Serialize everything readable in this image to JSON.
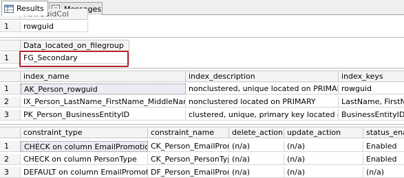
{
  "tabs": [
    {
      "label": "Results",
      "icon": "results-grid-icon",
      "active": true
    },
    {
      "label": "Messages",
      "icon": "messages-icon",
      "active": false
    }
  ],
  "grid1": {
    "columns": [
      "RowGuidCol"
    ],
    "rows": [
      [
        "1",
        "rowguid"
      ]
    ]
  },
  "grid2": {
    "columns": [
      "Data_located_on_filegroup"
    ],
    "rows": [
      [
        "1",
        "FG_Secondary"
      ]
    ]
  },
  "grid3": {
    "columns": [
      "index_name",
      "index_description",
      "index_keys"
    ],
    "rows": [
      [
        "1",
        "AK_Person_rowguid",
        "nonclustered, unique located on PRIMARY",
        "rowguid"
      ],
      [
        "2",
        "IX_Person_LastName_FirstName_MiddleName",
        "nonclustered located on PRIMARY",
        "LastName, FirstNa"
      ],
      [
        "3",
        "PK_Person_BusinessEntityID",
        "clustered, unique, primary key located on ...",
        "BusinessEntityID"
      ]
    ]
  },
  "grid4": {
    "columns": [
      "constraint_type",
      "constraint_name",
      "delete_action",
      "update_action",
      "status_ena"
    ],
    "rows": [
      [
        "1",
        "CHECK on column EmailPromotion",
        "CK_Person_EmailPromotion",
        "(n/a)",
        "(n/a)",
        "Enabled"
      ],
      [
        "2",
        "CHECK on column PersonType",
        "CK_Person_PersonType",
        "(n/a)",
        "(n/a)",
        "Enabled"
      ],
      [
        "3",
        "DEFAULT on column EmailPromotion",
        "DF_Person_EmailPromotion",
        "(n/a)",
        "(n/a)",
        "(n/a)"
      ]
    ]
  },
  "colors": {
    "highlight_box": "#b3202a",
    "header_bg": "#f4f4f4",
    "grid_line": "#d4d4d4"
  }
}
